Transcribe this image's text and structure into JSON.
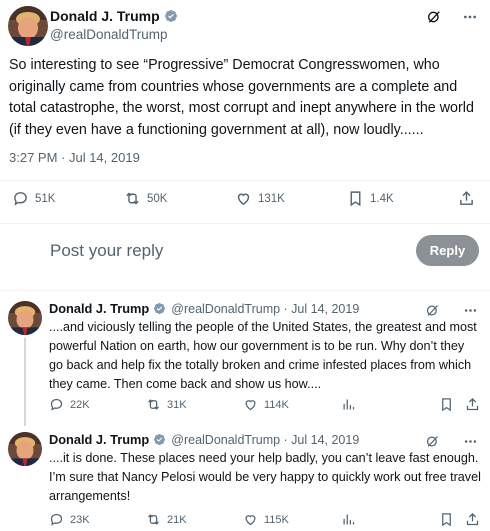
{
  "author": {
    "name": "Donald J. Trump",
    "handle": "@realDonaldTrump",
    "verified": true,
    "badge_color": "#829aab"
  },
  "main_tweet": {
    "text": "So interesting to see “Progressive” Democrat Congresswomen, who originally came from countries whose governments are a complete and total catastrophe, the worst, most corrupt and inept anywhere in the world (if they even have a functioning government at all), now loudly......",
    "timestamp": "3:27 PM · Jul 14, 2019",
    "stats": {
      "replies": "51K",
      "retweets": "50K",
      "likes": "131K",
      "bookmarks": "1.4K"
    }
  },
  "reply_composer": {
    "placeholder": "Post your reply",
    "button_label": "Reply"
  },
  "replies": [
    {
      "name": "Donald J. Trump",
      "handle_date": "@realDonaldTrump · Jul 14, 2019",
      "text": "....and viciously telling the people of the United States, the greatest and most powerful Nation on earth, how our government is to be run. Why don’t they go back and help fix the totally broken and crime infested places from which they came. Then come back and show us how....",
      "stats": {
        "replies": "22K",
        "retweets": "31K",
        "likes": "114K"
      }
    },
    {
      "name": "Donald J. Trump",
      "handle_date": "@realDonaldTrump · Jul 14, 2019",
      "text": "....it is done. These places need your help badly, you can’t leave fast enough. I’m sure that Nancy Pelosi would be very happy to quickly work out free travel arrangements!",
      "stats": {
        "replies": "23K",
        "retweets": "21K",
        "likes": "115K"
      }
    }
  ],
  "icons": {
    "reply": "reply-icon",
    "retweet": "retweet-icon",
    "like": "heart-icon",
    "bookmark": "bookmark-icon",
    "share": "share-icon",
    "views": "views-icon",
    "grok": "grok-icon",
    "more": "more-icon"
  },
  "colors": {
    "text": "#0f1419",
    "secondary": "#536471",
    "divider": "#eff3f4",
    "reply_button_bg": "#8b9196"
  }
}
